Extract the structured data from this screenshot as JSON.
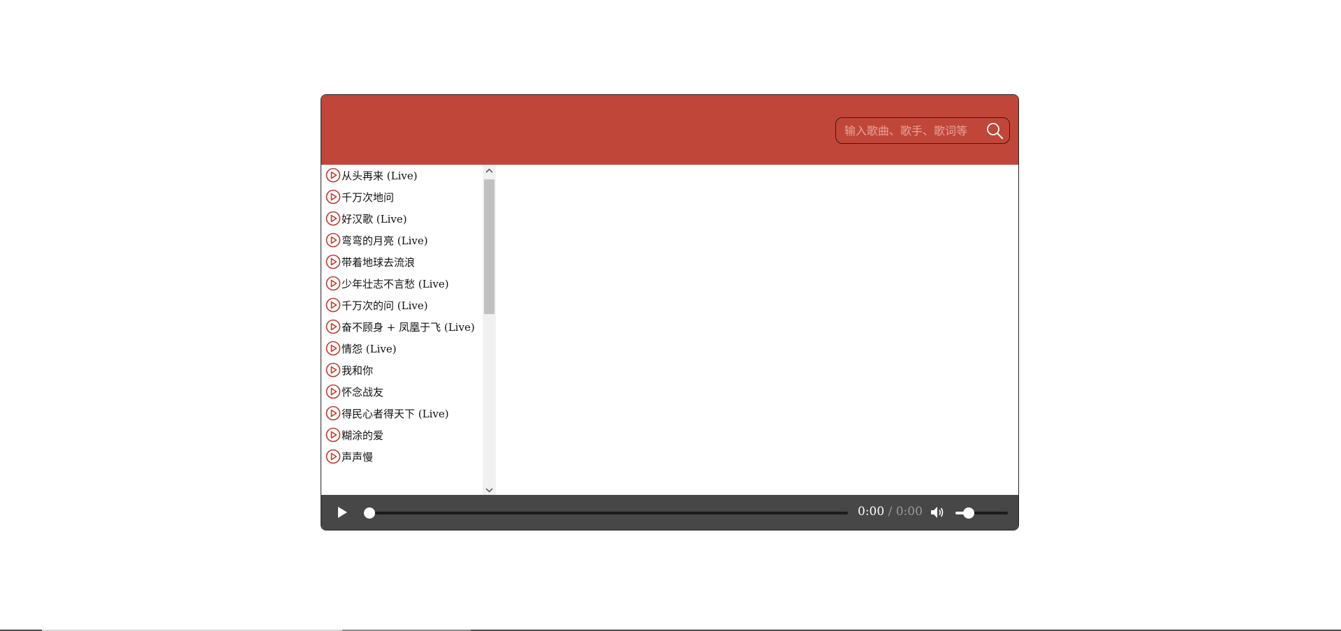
{
  "search": {
    "placeholder": "输入歌曲、歌手、歌词等",
    "icon": "search-icon"
  },
  "songs": [
    "从头再来 (Live)",
    "千万次地问",
    "好汉歌 (Live)",
    "弯弯的月亮 (Live)",
    "带着地球去流浪",
    "少年壮志不言愁 (Live)",
    "千万次的问 (Live)",
    "奋不顾身 + 凤凰于飞 (Live)",
    "情怨 (Live)",
    "我和你",
    "怀念战友",
    "得民心者得天下 (Live)",
    "糊涂的爱",
    "声声慢"
  ],
  "player": {
    "current_time": "0:00",
    "separator": " / ",
    "duration": "0:00",
    "progress": 0,
    "volume": 0.25
  },
  "colors": {
    "header": "#c0463a",
    "controls": "#474747",
    "play_icon": "#c0392b"
  }
}
